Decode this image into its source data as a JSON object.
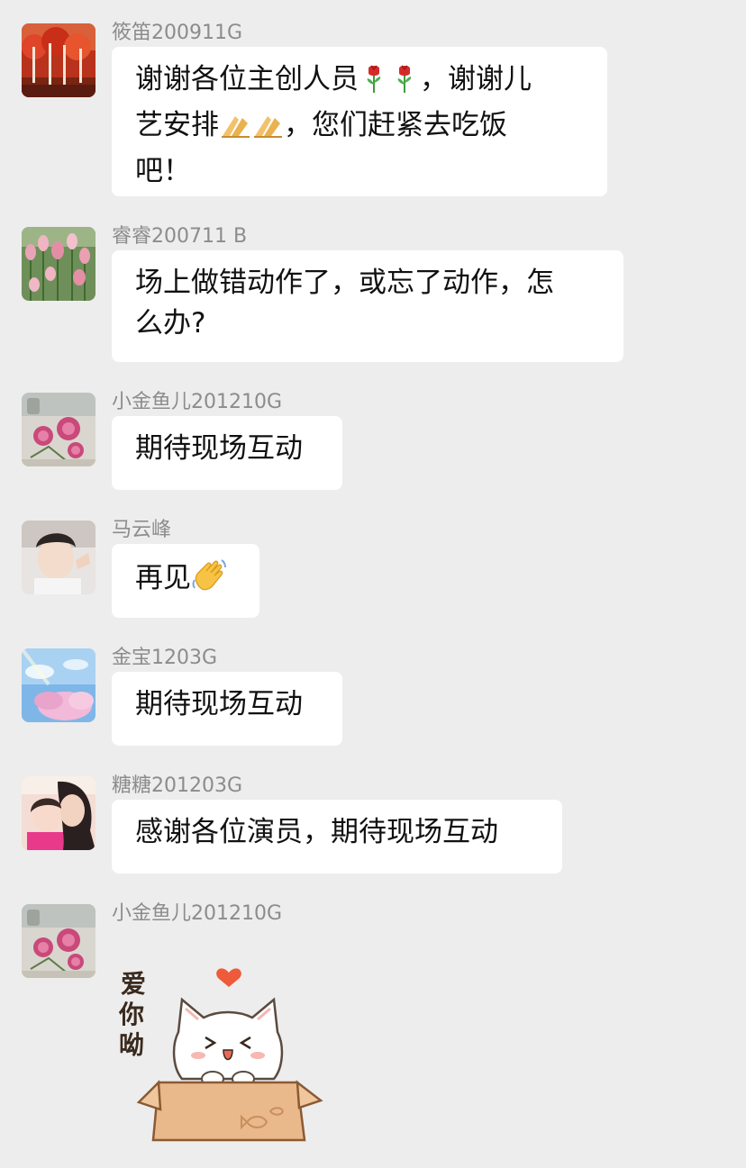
{
  "chat": {
    "messages": [
      {
        "sender": "筱笛200911G",
        "lines": [
          [
            "谢谢各位主创人员",
            "rose-emoji",
            "rose-emoji",
            "，谢谢儿"
          ],
          [
            "艺安排",
            "folded-hands-emoji",
            "folded-hands-emoji",
            "，您们赶紧去吃饭"
          ],
          [
            "吧！"
          ]
        ]
      },
      {
        "sender": "睿睿200711 B",
        "lines": [
          [
            "场上做错动作了，或忘了动作，怎"
          ],
          [
            "么办?"
          ]
        ]
      },
      {
        "sender": "小金鱼儿201210G",
        "lines": [
          [
            "期待现场互动"
          ]
        ]
      },
      {
        "sender": "马云峰",
        "lines": [
          [
            "再见",
            "waving-hand-emoji"
          ]
        ]
      },
      {
        "sender": "金宝1203G",
        "lines": [
          [
            "期待现场互动"
          ]
        ]
      },
      {
        "sender": "糖糖201203G",
        "lines": [
          [
            "感谢各位演员，期待现场互动"
          ]
        ]
      },
      {
        "sender": "小金鱼儿201210G",
        "sticker": {
          "icon": "cat-in-box-sticker",
          "text": "爱你呦"
        }
      }
    ]
  },
  "colors": {
    "background": "#ededed",
    "bubble": "#ffffff",
    "sender_name": "#8c8c8c",
    "text": "#111111"
  }
}
